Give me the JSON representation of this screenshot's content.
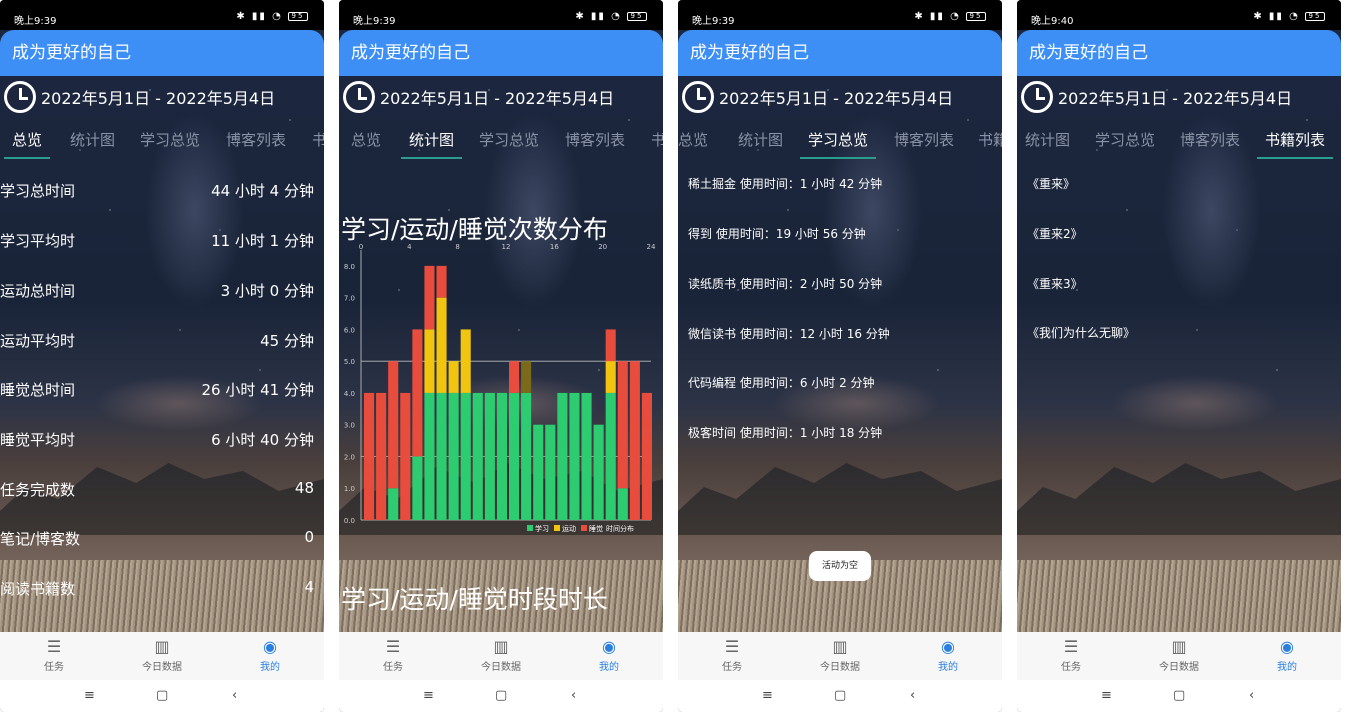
{
  "status_times": [
    "晚上9:39",
    "晚上9:39",
    "晚上9:39",
    "晚上9:40"
  ],
  "app_title": "成为更好的自己",
  "date_range": "2022年5月1日 - 2022年5月4日",
  "tabs": [
    "总览",
    "统计图",
    "学习总览",
    "博客列表",
    "书籍列表"
  ],
  "overview_stats": [
    {
      "label": "学习总时间",
      "value": "44 小时 4 分钟"
    },
    {
      "label": "学习平均时",
      "value": "11 小时 1 分钟"
    },
    {
      "label": "运动总时间",
      "value": "3 小时 0 分钟"
    },
    {
      "label": "运动平均时",
      "value": "45 分钟"
    },
    {
      "label": "睡觉总时间",
      "value": "26 小时 41 分钟"
    },
    {
      "label": "睡觉平均时",
      "value": "6 小时 40 分钟"
    },
    {
      "label": "任务完成数",
      "value": "48"
    },
    {
      "label": "笔记/博客数",
      "value": "0"
    },
    {
      "label": "阅读书籍数",
      "value": "4"
    }
  ],
  "chart_section_title": "学习/运动/睡觉次数分布",
  "chart_section_title2": "学习/运动/睡觉时段时长",
  "chart_data": {
    "type": "bar",
    "stacked": true,
    "x": [
      0,
      1,
      2,
      3,
      4,
      5,
      6,
      7,
      8,
      9,
      10,
      11,
      12,
      13,
      14,
      15,
      16,
      17,
      18,
      19,
      20,
      21,
      22,
      23
    ],
    "x_ticks": [
      "0",
      "4",
      "8",
      "12",
      "16",
      "20",
      "24"
    ],
    "y_ticks": [
      "0.0",
      "1.0",
      "2.0",
      "3.0",
      "4.0",
      "5.0",
      "6.0",
      "7.0",
      "8.0"
    ],
    "ylim": [
      0,
      8.5
    ],
    "limit_lines": [
      2,
      5
    ],
    "series": [
      {
        "name": "学习",
        "color": "#2ecc71",
        "values": [
          0,
          0,
          1,
          0,
          2,
          4,
          4,
          4,
          4,
          4,
          4,
          4,
          4,
          4,
          3,
          3,
          4,
          4,
          4,
          3,
          4,
          1,
          0,
          0
        ]
      },
      {
        "name": "运动",
        "color": "#f1c40f",
        "values": [
          0,
          0,
          0,
          0,
          0,
          2,
          3,
          1,
          2,
          0,
          0,
          0,
          0,
          0,
          0,
          0,
          0,
          0,
          0,
          0,
          1,
          0,
          0,
          0
        ]
      },
      {
        "name": "睡觉",
        "color": "#e74c3c",
        "values": [
          4,
          4,
          4,
          4,
          4,
          2,
          1,
          0,
          0,
          0,
          0,
          0,
          1,
          0,
          0,
          0,
          0,
          0,
          0,
          0,
          1,
          4,
          5,
          4
        ]
      }
    ],
    "highlight": {
      "index": 13,
      "color": "#7a6a1a",
      "value": [
        4,
        5
      ]
    },
    "legend_suffix": "时间分布"
  },
  "usage_list": [
    "稀土掘金 使用时间：1 小时 42 分钟",
    "得到 使用时间：19 小时 56 分钟",
    "读纸质书 使用时间：2 小时 50 分钟",
    "微信读书 使用时间：12 小时 16 分钟",
    "代码编程 使用时间：6 小时 2 分钟",
    "极客时间 使用时间：1 小时 18 分钟"
  ],
  "toast": "活动为空",
  "books": [
    "《重来》",
    "《重来2》",
    "《重来3》",
    "《我们为什么无聊》"
  ],
  "bottom_nav": [
    "任务",
    "今日数据",
    "我的"
  ],
  "colors": {
    "primary": "#3d8ff5",
    "tab_indicator": "#2a9d8f",
    "nav_active": "#2a7fe0"
  }
}
